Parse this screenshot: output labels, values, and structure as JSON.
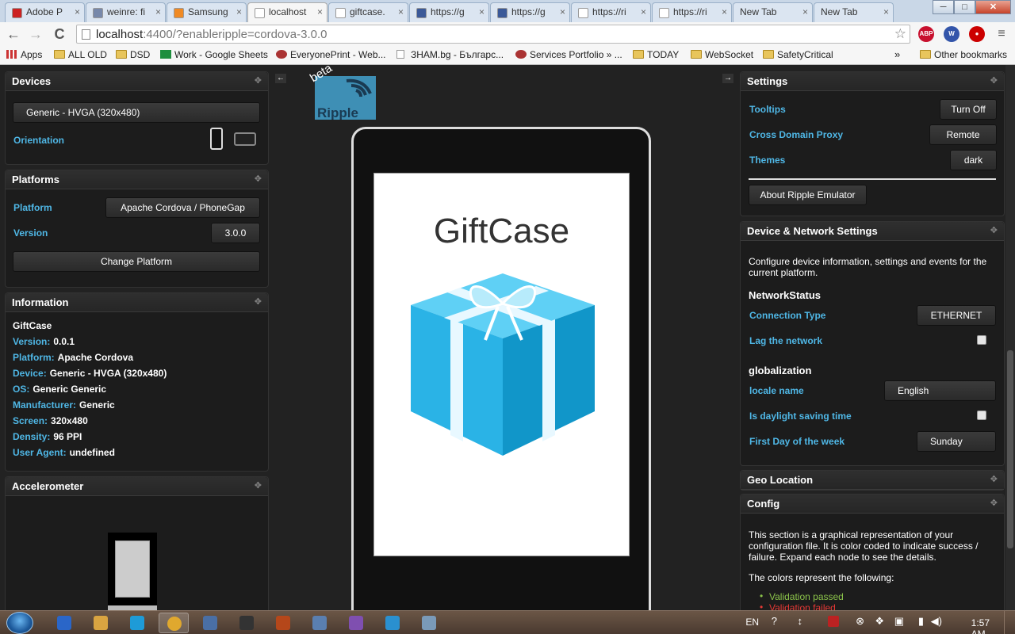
{
  "browser": {
    "tabs": [
      {
        "label": "Adobe P",
        "icon_color": "#cc2222"
      },
      {
        "label": "weinre: fi",
        "icon_color": "#7788aa"
      },
      {
        "label": "Samsung",
        "icon_color": "#f08a24"
      },
      {
        "label": "localhost",
        "icon_color": "#ffffff"
      },
      {
        "label": "giftcase.",
        "icon_color": "#ffffff"
      },
      {
        "label": "https://g",
        "icon_color": "#3b5998"
      },
      {
        "label": "https://g",
        "icon_color": "#3b5998"
      },
      {
        "label": "https://ri",
        "icon_color": "#ffffff"
      },
      {
        "label": "https://ri",
        "icon_color": "#ffffff"
      },
      {
        "label": "New Tab",
        "icon_color": ""
      },
      {
        "label": "New Tab",
        "icon_color": ""
      }
    ],
    "active_tab": 3,
    "url_host": "localhost",
    "url_path": ":4400/?enableripple=cordova-3.0.0",
    "extensions": [
      {
        "label": "ABP",
        "color": "#c8102e"
      },
      {
        "label": "W",
        "color": "#3355aa"
      },
      {
        "label": "●",
        "color": "#cc0000"
      }
    ],
    "bookmarks": [
      {
        "label": "Apps",
        "kind": "apps"
      },
      {
        "label": "ALL OLD",
        "kind": "folder"
      },
      {
        "label": "DSD",
        "kind": "folder"
      },
      {
        "label": "Work - Google Sheets",
        "kind": "sheet"
      },
      {
        "label": "EveryonePrint - Web...",
        "kind": "site"
      },
      {
        "label": "ЗНАМ.bg - Българс...",
        "kind": "page"
      },
      {
        "label": "Services Portfolio » ...",
        "kind": "site"
      },
      {
        "label": "TODAY",
        "kind": "folder"
      },
      {
        "label": "WebSocket",
        "kind": "folder"
      },
      {
        "label": "SafetyCritical",
        "kind": "folder"
      }
    ],
    "bookmarks_more": "»",
    "other_bookmarks": "Other bookmarks",
    "window_controls": {
      "minimize": "─",
      "maximize": "□",
      "close": "✕"
    },
    "nav": {
      "back": "←",
      "forward": "→",
      "reload": "C"
    }
  },
  "ripple": {
    "collapse_left": "←",
    "collapse_right": "→",
    "logo_text": "Ripple",
    "logo_badge": "beta",
    "devices": {
      "title": "Devices",
      "device_value": "Generic - HVGA (320x480)",
      "orientation_label": "Orientation"
    },
    "platforms": {
      "title": "Platforms",
      "platform_label": "Platform",
      "platform_value": "Apache Cordova / PhoneGap",
      "version_label": "Version",
      "version_value": "3.0.0",
      "change_button": "Change Platform"
    },
    "information": {
      "title": "Information",
      "app_name": "GiftCase",
      "rows": [
        {
          "k": "Version:",
          "v": "0.0.1"
        },
        {
          "k": "Platform:",
          "v": "Apache Cordova"
        },
        {
          "k": "Device:",
          "v": "Generic - HVGA (320x480)"
        },
        {
          "k": "OS:",
          "v": "Generic Generic"
        },
        {
          "k": "Manufacturer:",
          "v": "Generic"
        },
        {
          "k": "Screen:",
          "v": "320x480"
        },
        {
          "k": "Density:",
          "v": "96 PPI"
        },
        {
          "k": "User Agent:",
          "v": "undefined"
        }
      ]
    },
    "accelerometer": {
      "title": "Accelerometer"
    },
    "settings": {
      "title": "Settings",
      "tooltips_label": "Tooltips",
      "tooltips_value": "Turn Off",
      "proxy_label": "Cross Domain Proxy",
      "proxy_value": "Remote",
      "themes_label": "Themes",
      "themes_value": "dark",
      "about_button": "About Ripple Emulator"
    },
    "device_network": {
      "title": "Device & Network Settings",
      "description": "Configure device information, settings and events for the current platform.",
      "network_heading": "NetworkStatus",
      "connection_label": "Connection Type",
      "connection_value": "ETHERNET",
      "lag_label": "Lag the network",
      "glob_heading": "globalization",
      "locale_label": "locale name",
      "locale_value": "English",
      "dst_label": "Is daylight saving time",
      "firstday_label": "First Day of the week",
      "firstday_value": "Sunday"
    },
    "geo": {
      "title": "Geo Location"
    },
    "config": {
      "title": "Config",
      "description": "This section is a graphical representation of your configuration file. It is color coded to indicate success / failure. Expand each node to see the details.",
      "colors_intro": "The colors represent the following:",
      "legend": [
        {
          "label": "Validation passed",
          "color": "#8bc34a"
        },
        {
          "label": "Validation failed",
          "color": "#e53935"
        }
      ]
    },
    "move_icon": "✥"
  },
  "device_screen": {
    "app_title": "GiftCase",
    "gift_colors": {
      "light": "#5fd0f5",
      "mid": "#2ab3e6",
      "dark": "#1196c9"
    }
  },
  "taskbar": {
    "language": "EN",
    "time": "1:57 AM"
  }
}
